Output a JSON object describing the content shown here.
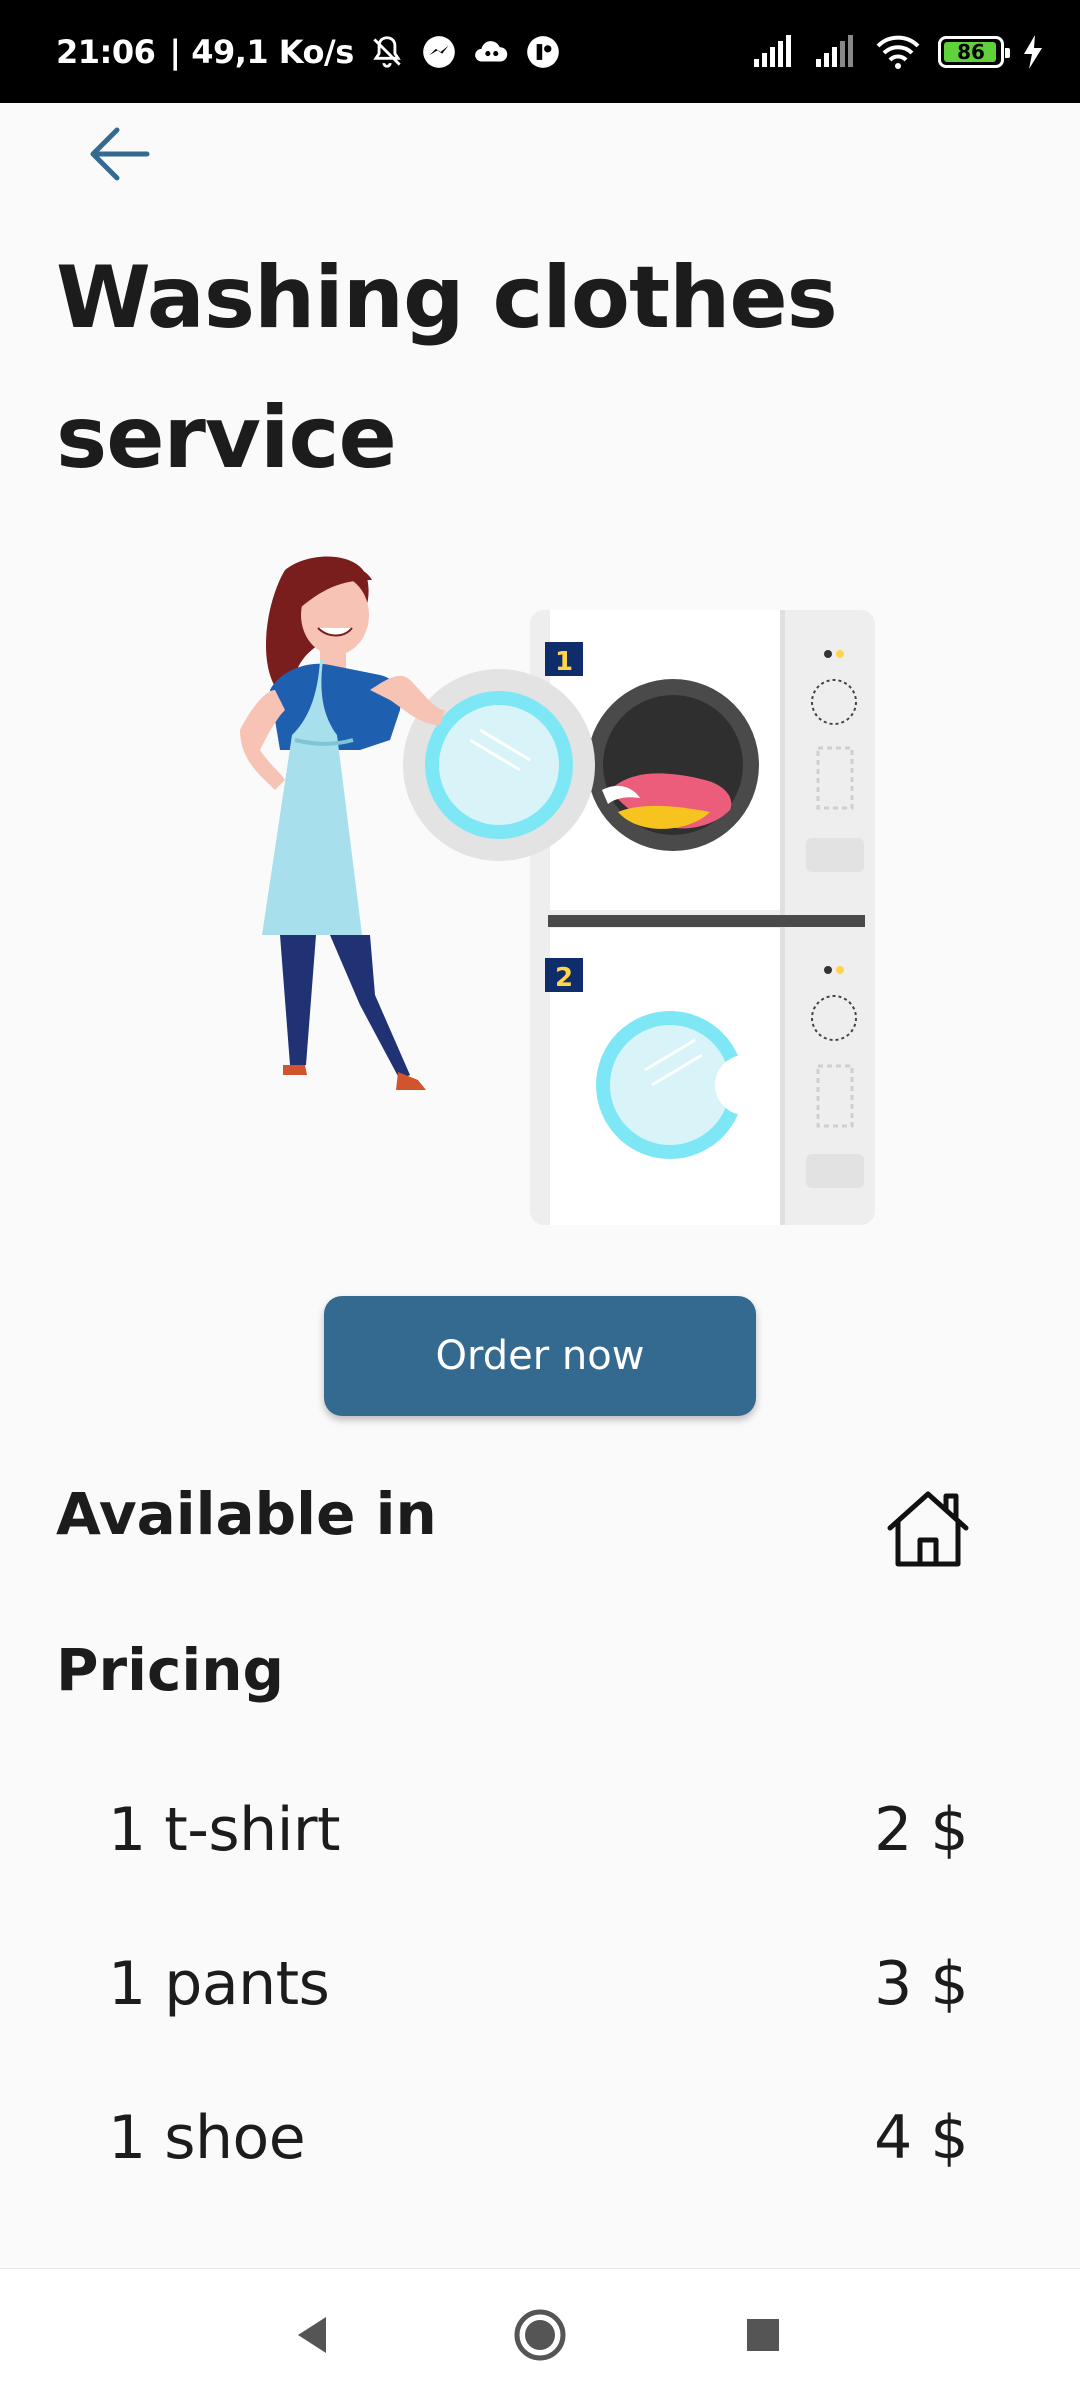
{
  "status_bar": {
    "time": "21:06",
    "speed": "| 49,1 Ko/s",
    "battery": "86",
    "icons": [
      "mute-bell-icon",
      "messenger-icon",
      "cloud-icon",
      "app-icon",
      "signal-icon",
      "wifi-icon",
      "battery-icon",
      "charging-icon"
    ]
  },
  "header": {
    "back_icon": "arrow-left-icon",
    "title": "Washing clothes service"
  },
  "illustration": {
    "machine_1_label": "1",
    "machine_2_label": "2"
  },
  "actions": {
    "order_label": "Order now"
  },
  "availability": {
    "heading": "Available in",
    "icon": "home-icon"
  },
  "pricing": {
    "heading": "Pricing",
    "items": [
      {
        "name": "1 t-shirt",
        "price": "2 $"
      },
      {
        "name": "1 pants",
        "price": "3 $"
      },
      {
        "name": "1 shoe",
        "price": "4 $"
      }
    ]
  },
  "colors": {
    "primary": "#346990",
    "background": "#fafafa",
    "text": "#1c1c1c"
  },
  "nav": {
    "icons": [
      "back-triangle-icon",
      "home-circle-icon",
      "recents-square-icon"
    ]
  }
}
